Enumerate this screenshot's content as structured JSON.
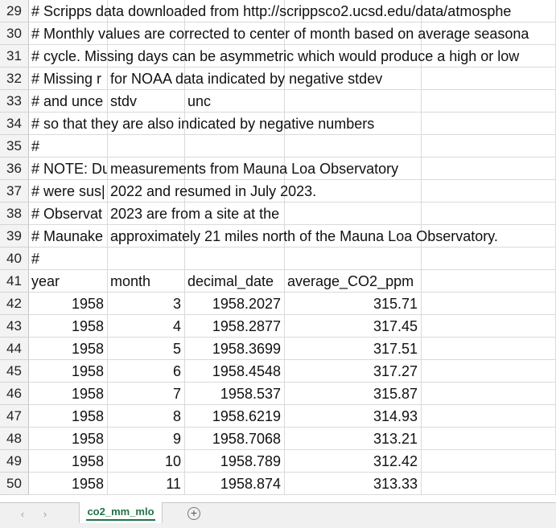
{
  "rows": [
    {
      "num": "29",
      "a": "# Scripps data downloaded from http://scrippsco2.ucsd.edu/data/atmosphe"
    },
    {
      "num": "30",
      "a": "# Monthly values are corrected to center of month based on average seasona"
    },
    {
      "num": "31",
      "a": "# cycle. Missing days can be asymmetric which would produce a high or low"
    },
    {
      "num": "32",
      "a": "# Missing r",
      "b": "for NOAA data indicated by negative stdev"
    },
    {
      "num": "33",
      "a": "# and unce",
      "b": "stdv",
      "c": "unc"
    },
    {
      "num": "34",
      "a": "# so that they are also indicated by negative numbers"
    },
    {
      "num": "35",
      "a": "#"
    },
    {
      "num": "36",
      "a": "# NOTE: Du",
      "b": "measurements from Mauna Loa Observatory"
    },
    {
      "num": "37",
      "a": "# were sus|",
      "b": "2022 and resumed in July 2023."
    },
    {
      "num": "38",
      "a": "# Observat",
      "b": "2023 are from a site at the"
    },
    {
      "num": "39",
      "a": "# Maunake",
      "b": "approximately 21 miles north of the Mauna Loa Observatory."
    },
    {
      "num": "40",
      "a": "#"
    }
  ],
  "headers": {
    "num": "41",
    "year": "year",
    "month": "month",
    "decimal_date": "decimal_date",
    "average": "average_CO2_ppm"
  },
  "data_rows": [
    {
      "num": "42",
      "year": "1958",
      "month": "3",
      "decimal": "1958.2027",
      "avg": "315.71"
    },
    {
      "num": "43",
      "year": "1958",
      "month": "4",
      "decimal": "1958.2877",
      "avg": "317.45"
    },
    {
      "num": "44",
      "year": "1958",
      "month": "5",
      "decimal": "1958.3699",
      "avg": "317.51"
    },
    {
      "num": "45",
      "year": "1958",
      "month": "6",
      "decimal": "1958.4548",
      "avg": "317.27"
    },
    {
      "num": "46",
      "year": "1958",
      "month": "7",
      "decimal": "1958.537",
      "avg": "315.87"
    },
    {
      "num": "47",
      "year": "1958",
      "month": "8",
      "decimal": "1958.6219",
      "avg": "314.93"
    },
    {
      "num": "48",
      "year": "1958",
      "month": "9",
      "decimal": "1958.7068",
      "avg": "313.21"
    },
    {
      "num": "49",
      "year": "1958",
      "month": "10",
      "decimal": "1958.789",
      "avg": "312.42"
    },
    {
      "num": "50",
      "year": "1958",
      "month": "11",
      "decimal": "1958.874",
      "avg": "313.33"
    }
  ],
  "sheet_tab": {
    "label": "co2_mm_mlo",
    "add_symbol": "+",
    "prev_arrow": "‹",
    "next_arrow": "›"
  }
}
